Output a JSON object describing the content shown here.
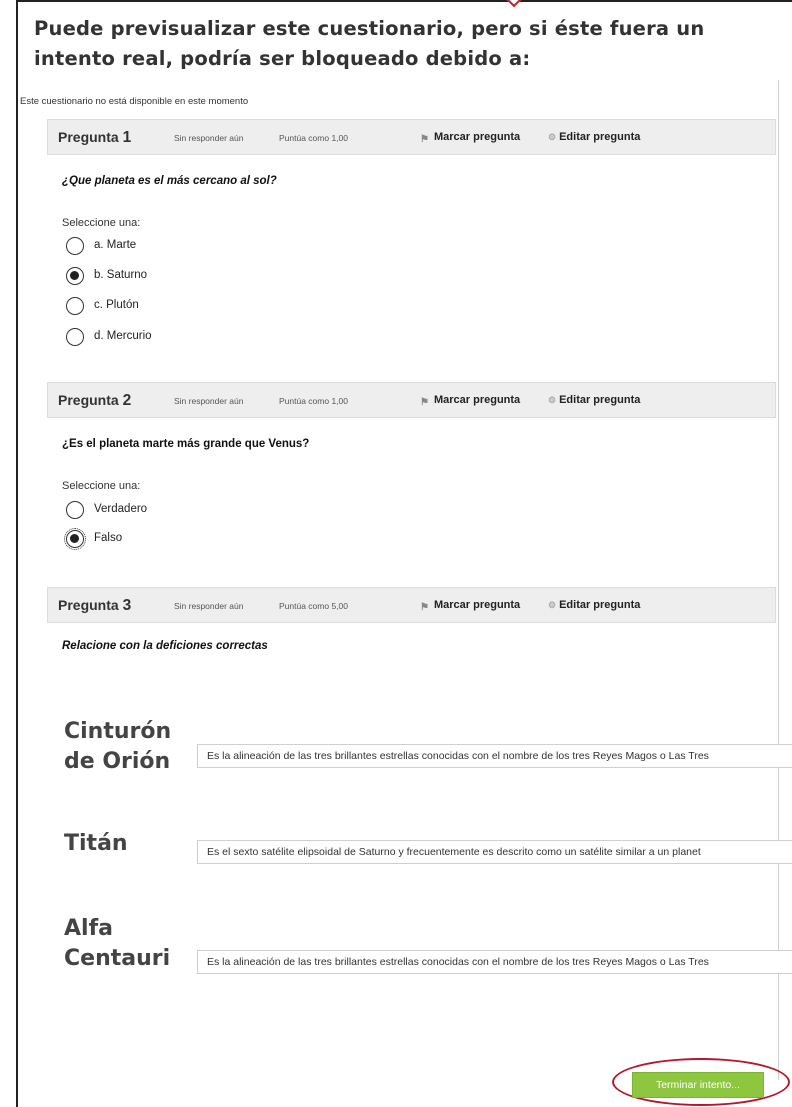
{
  "heading": "Puede previsualizar este cuestionario, pero si éste fuera un intento real, podría ser bloqueado debido a:",
  "notice": "Este cuestionario no está disponible en este momento",
  "questions": [
    {
      "title": "Pregunta",
      "number": "1",
      "state": "Sin responder aún",
      "grade": "Puntúa como 1,00",
      "flag": "Marcar pregunta",
      "edit": "Editar pregunta",
      "text": "¿Que planeta es el más cercano al sol?",
      "prompt": "Seleccione una:",
      "options": [
        "a. Marte",
        "b. Saturno",
        "c. Plutón",
        "d. Mercurio"
      ],
      "selected": 1
    },
    {
      "title": "Pregunta",
      "number": "2",
      "state": "Sin responder aún",
      "grade": "Puntúa como 1,00",
      "flag": "Marcar pregunta",
      "edit": "Editar pregunta",
      "text": "¿Es el planeta marte más grande que Venus?",
      "prompt": "Seleccione una:",
      "options": [
        "Verdadero",
        "Falso"
      ],
      "selected": 1
    },
    {
      "title": "Pregunta",
      "number": "3",
      "state": "Sin responder aún",
      "grade": "Puntúa como 5,00",
      "flag": "Marcar pregunta",
      "edit": "Editar pregunta",
      "text": "Relacione con la deficiones correctas",
      "matches": [
        {
          "term_line1": "Cinturón",
          "term_line2": "de Orión",
          "answer": "Es la alineación de las tres brillantes estrellas conocidas con el nombre de los tres Reyes Magos o Las Tres"
        },
        {
          "term_line1": "Titán",
          "term_line2": "",
          "answer": "Es el sexto satélite elipsoidal de Saturno y frecuentemente es descrito como un satélite similar a un planet"
        },
        {
          "term_line1": "Alfa",
          "term_line2": "Centauri",
          "answer": "Es la alineación de las tres brillantes estrellas conocidas con el nombre de los tres Reyes Magos o Las Tres"
        }
      ]
    }
  ],
  "finish_button": "Terminar intento...",
  "icons": {
    "flag": "flag-icon",
    "edit": "gear-icon"
  },
  "colors": {
    "finish": "#8dc63f",
    "annotation": "#b3182b",
    "bar": "#eeeeee"
  }
}
